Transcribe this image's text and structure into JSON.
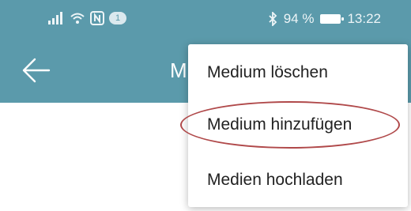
{
  "status_bar": {
    "notification_count": "1",
    "battery_percent": "94 %",
    "time": "13:22",
    "icons": [
      "signal-icon",
      "wifi-icon",
      "nfc-icon",
      "bluetooth-icon",
      "battery-icon"
    ]
  },
  "app_bar": {
    "title_partial": "M",
    "back_icon": "back-arrow-icon"
  },
  "menu": {
    "items": [
      {
        "label": "Medium löschen"
      },
      {
        "label": "Medium hinzufügen",
        "highlighted": true
      },
      {
        "label": "Medien hochladen"
      }
    ]
  },
  "colors": {
    "app_bar": "#5b9aab",
    "highlight_ring": "#b0494a"
  }
}
